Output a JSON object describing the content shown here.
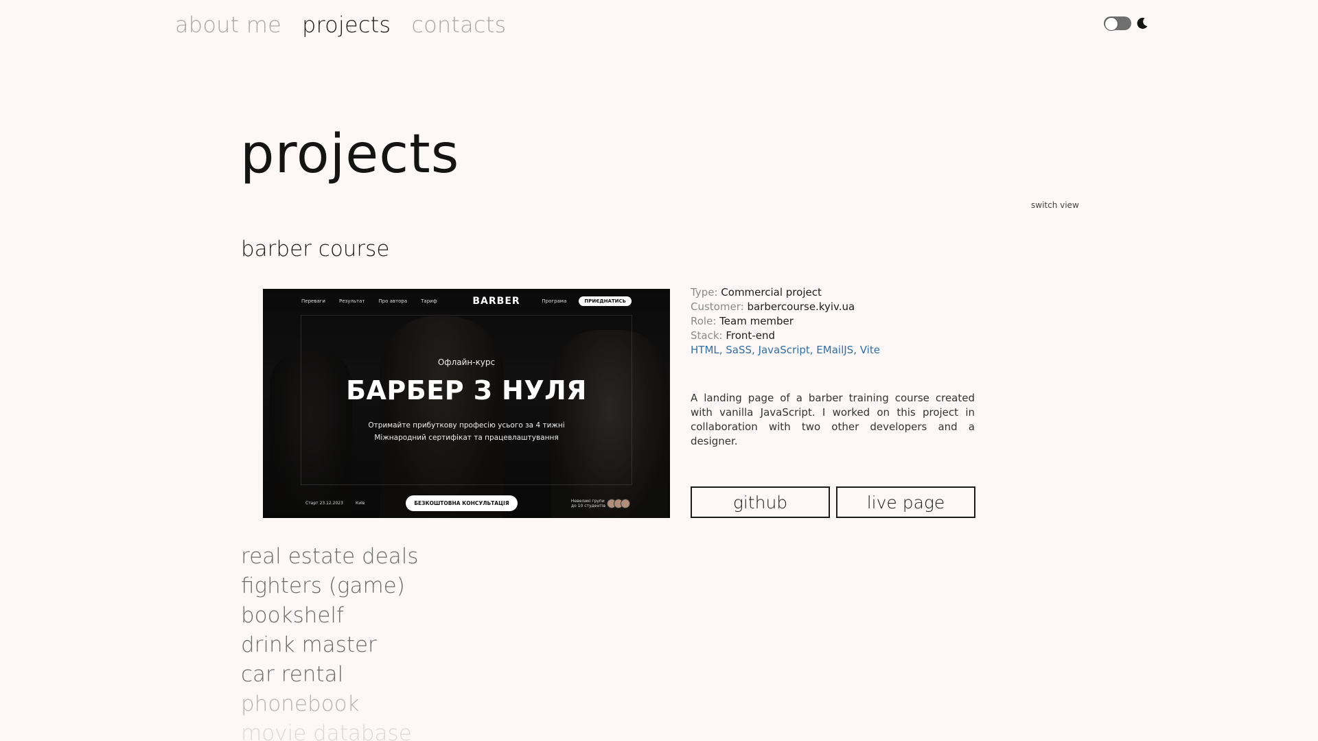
{
  "nav": {
    "items": [
      {
        "label": "about me"
      },
      {
        "label": "projects"
      },
      {
        "label": "contacts"
      }
    ]
  },
  "page": {
    "title": "projects",
    "switch_view": "switch view"
  },
  "project": {
    "name": "barber course",
    "preview": {
      "nav": [
        "Переваги",
        "Результат",
        "Про автора",
        "Тариф"
      ],
      "logo": "BARBER",
      "program": "Програма",
      "join": "ПРИЄДНАТИСЬ",
      "subtitle": "Офлайн-курс",
      "headline": "БАРБЕР З НУЛЯ",
      "desc_line1": "Отримайте прибуткову професію усього за 4 тижні",
      "desc_line2": "Міжнародний сертифікат та працевлаштування",
      "start": "Старт 23.12.2023",
      "city": "Київ",
      "cta": "БЕЗКОШТОВНА КОНСУЛЬТАЦІЯ",
      "group_line1": "Невеликі групи",
      "group_line2": "до 10 студентів"
    },
    "details": [
      {
        "label": "Type:",
        "value": "Commercial project"
      },
      {
        "label": "Customer:",
        "value": "barbercourse.kyiv.ua"
      },
      {
        "label": "Role:",
        "value": "Team member"
      },
      {
        "label": "Stack:",
        "value": "Front-end"
      }
    ],
    "stack": "HTML, SaSS, JavaScript, EMailJS, Vite",
    "description": "A landing page of a barber training course created with vanilla JavaScript. I worked on this project in collaboration with two other developers and a designer.",
    "buttons": {
      "github": "github",
      "live": "live page"
    }
  },
  "projects_list": [
    "real estate deals",
    "fighters (game)",
    "bookshelf",
    "drink master",
    "car rental",
    "phonebook",
    "movie database"
  ],
  "colors": {
    "background": "#fdf8f7",
    "text": "#1a1a1a",
    "muted": "#a9a6a6",
    "link": "#2f6fa6"
  }
}
